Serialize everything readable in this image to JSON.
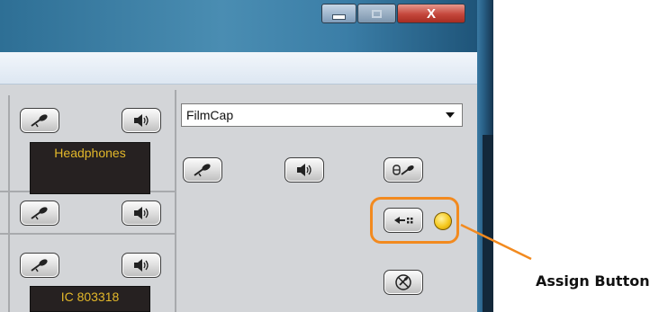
{
  "window": {
    "controls": {
      "minimize_icon": "minimize-icon",
      "maximize_icon": "maximize-icon",
      "close_label": "X"
    }
  },
  "left_channels": {
    "row1": {
      "mic_icon": "microphone-icon",
      "speaker_icon": "speaker-icon",
      "display": "Headphones"
    },
    "row2": {
      "mic_icon": "microphone-icon",
      "speaker_icon": "speaker-icon"
    },
    "row3": {
      "mic_icon": "microphone-icon",
      "speaker_icon": "speaker-icon",
      "display": "IC 803318"
    }
  },
  "right_panel": {
    "dropdown_value": "FilmCap",
    "buttons": [
      "microphone-icon",
      "speaker-icon",
      "headset-mic-icon",
      "assign-icon",
      "mute-icon"
    ],
    "indicator_color": "#f5c91e"
  },
  "annotation": {
    "label": "Assign Button",
    "color": "#f28a1f"
  }
}
